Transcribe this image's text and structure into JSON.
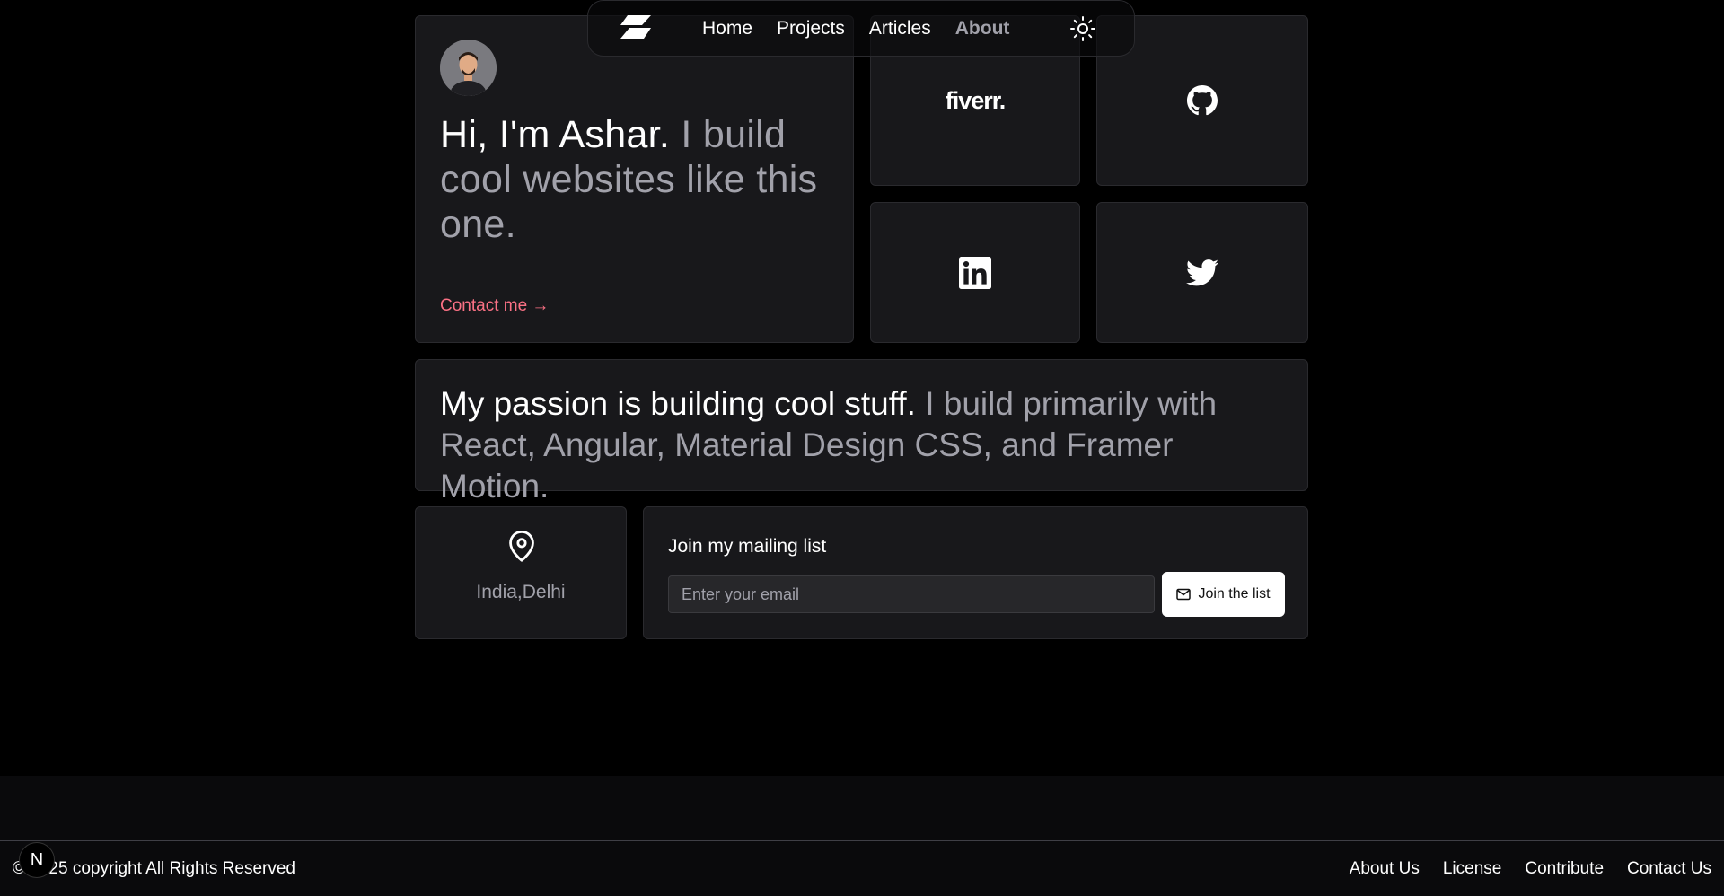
{
  "nav": {
    "links": [
      {
        "label": "Home",
        "active": false
      },
      {
        "label": "Projects",
        "active": false
      },
      {
        "label": "Articles",
        "active": false
      },
      {
        "label": "About",
        "active": true
      }
    ],
    "theme_icon": "sun-icon"
  },
  "hero": {
    "headline_strong": "Hi, I'm Ashar.",
    "headline_muted": " I build cool websites like this one.",
    "contact_label": "Contact me →"
  },
  "social": {
    "fiverr_label": "fiverr.",
    "icons": [
      "fiverr-logo",
      "github-icon",
      "linkedin-icon",
      "twitter-icon"
    ]
  },
  "passion": {
    "strong": "My passion is building cool stuff.",
    "muted": " I build primarily with React, Angular, Material Design CSS, and Framer Motion."
  },
  "location": {
    "city": "India,Delhi"
  },
  "mailing": {
    "title": "Join my mailing list",
    "placeholder": "Enter your email",
    "button_label": "Join the list"
  },
  "footer": {
    "copyright": "© 2025 copyright All Rights Reserved",
    "links": [
      "About Us",
      "License",
      "Contribute",
      "Contact Us"
    ],
    "badge": "N"
  },
  "colors": {
    "background": "#000000",
    "card": "#18181b",
    "accent_contact": "#fb7185",
    "muted_text": "#a1a1aa"
  }
}
